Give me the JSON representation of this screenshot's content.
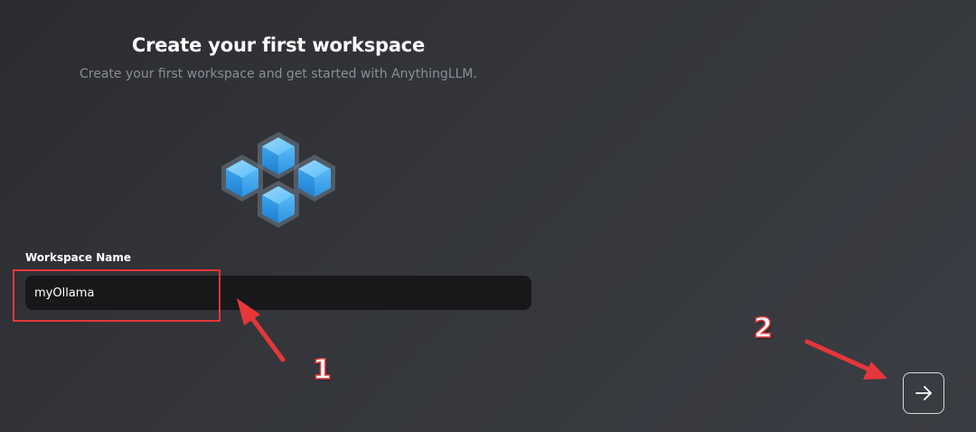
{
  "header": {
    "title": "Create your first workspace",
    "subtitle": "Create your first workspace and get started with AnythingLLM."
  },
  "illustration": {
    "icon": "workspace-cubes-icon",
    "color": "#4fb3f6"
  },
  "form": {
    "label": "Workspace Name",
    "value": "myOllama"
  },
  "navigation": {
    "next_icon": "arrow-right-icon"
  },
  "annotations": {
    "step1": "1",
    "step2": "2",
    "color": "#e5373a"
  }
}
